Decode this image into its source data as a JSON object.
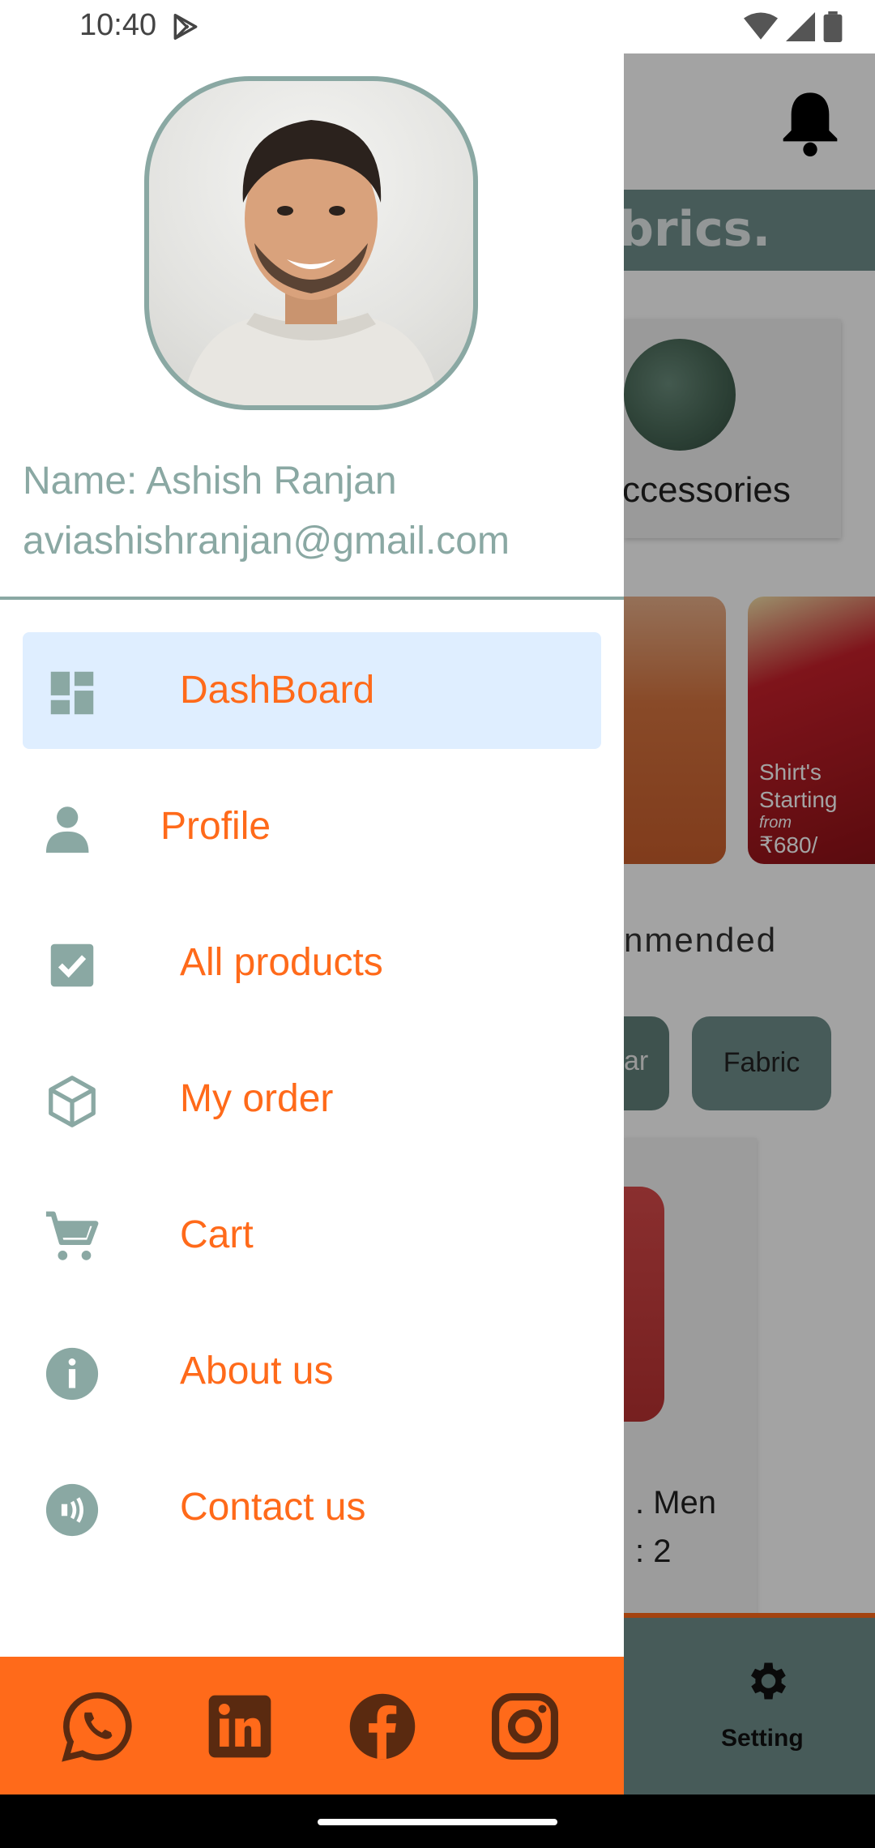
{
  "status_bar": {
    "time": "10:40"
  },
  "drawer": {
    "user": {
      "name_line": "Name: Ashish Ranjan",
      "email_line": "aviashishranjan@gmail.com"
    },
    "menu": [
      {
        "label": "DashBoard",
        "icon": "dashboard-icon",
        "active": true
      },
      {
        "label": "Profile",
        "icon": "person-icon",
        "active": false
      },
      {
        "label": "All products",
        "icon": "checkbox-icon",
        "active": false
      },
      {
        "label": "My order",
        "icon": "box-icon",
        "active": false
      },
      {
        "label": "Cart",
        "icon": "cart-icon",
        "active": false
      },
      {
        "label": "About us",
        "icon": "info-icon",
        "active": false
      },
      {
        "label": "Contact us",
        "icon": "contact-icon",
        "active": false
      }
    ],
    "social": [
      "whatsapp-icon",
      "linkedin-icon",
      "facebook-icon",
      "instagram-icon"
    ]
  },
  "background_app": {
    "banner_text": "brics.",
    "category_label": "ccessories",
    "promo_line1": "Shirt's",
    "promo_line2": "Starting",
    "promo_line3": "from",
    "promo_line4": "₹680/",
    "section_title": "nmended",
    "chip1": "ar",
    "chip2": "Fabric",
    "product_line1": ". Men",
    "product_line2": ": 2",
    "bottom_nav_label": "Setting"
  },
  "colors": {
    "accent_orange": "#ff6a1a",
    "sage": "#8aa8a3",
    "active_bg": "#dfeeff"
  }
}
